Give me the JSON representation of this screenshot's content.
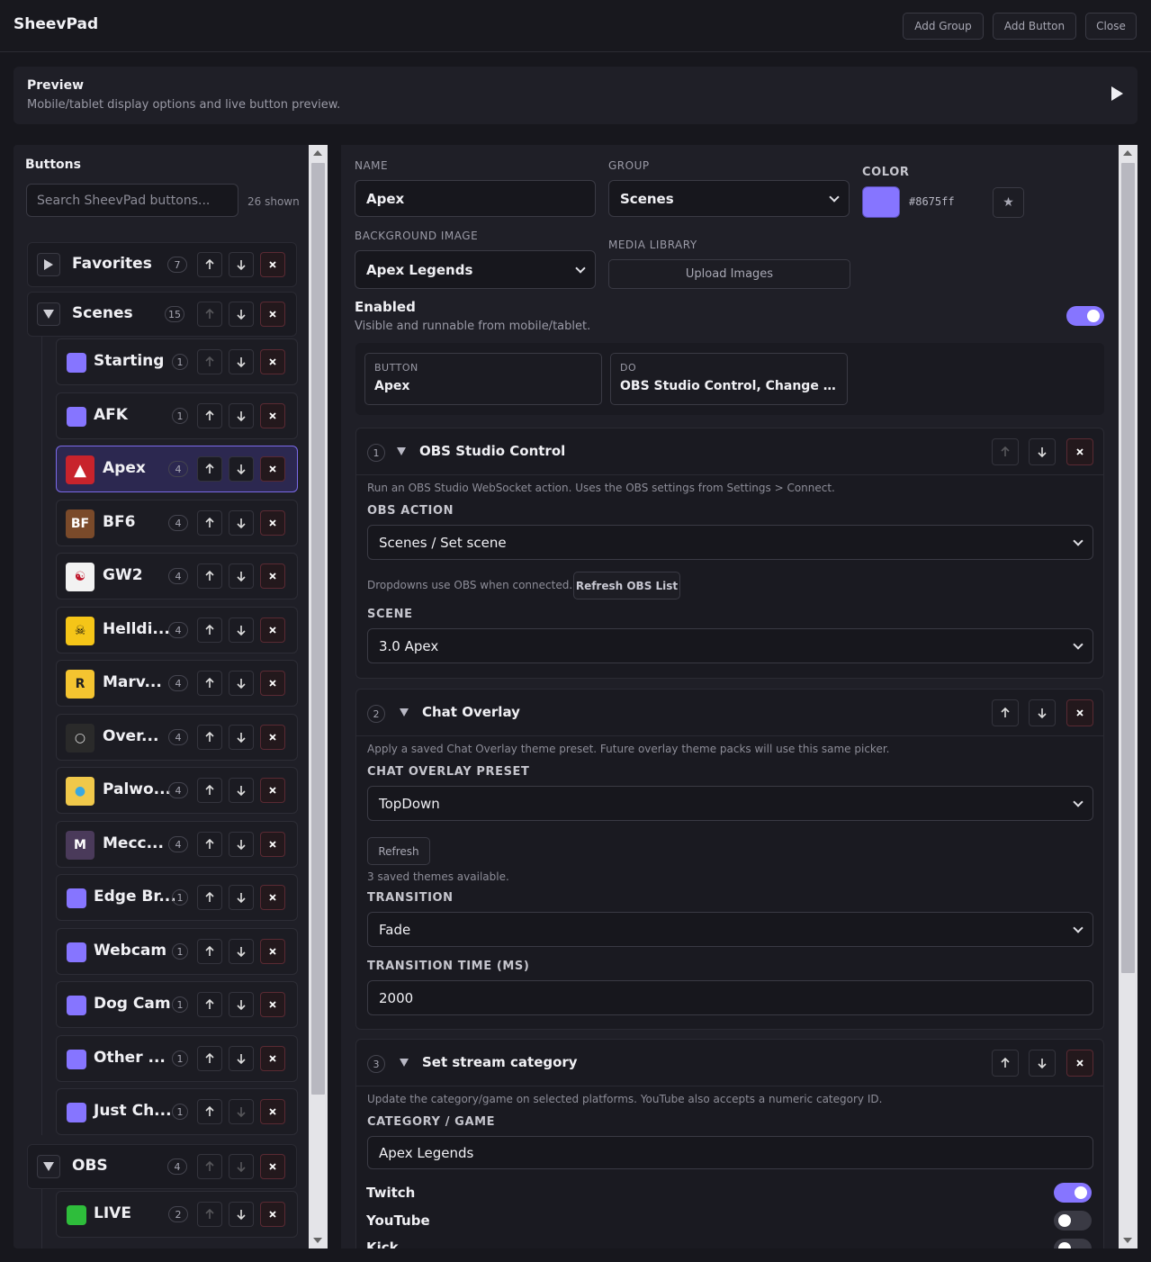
{
  "app": {
    "title": "SheevPad"
  },
  "toolbar": {
    "add_group": "Add Group",
    "add_button": "Add Button",
    "close": "Close"
  },
  "preview": {
    "title": "Preview",
    "subtitle": "Mobile/tablet display options and live button preview."
  },
  "buttons_panel": {
    "heading": "Buttons",
    "search_placeholder": "Search SheevPad buttons...",
    "shown": "26 shown",
    "groups": [
      {
        "name": "Favorites",
        "count": "7"
      },
      {
        "name": "Scenes",
        "count": "15"
      },
      {
        "name": "OBS",
        "count": "4"
      }
    ],
    "items": [
      {
        "name": "Starting",
        "count": "1"
      },
      {
        "name": "AFK",
        "count": "1"
      },
      {
        "name": "Apex",
        "count": "4"
      },
      {
        "name": "BF6",
        "count": "4"
      },
      {
        "name": "GW2",
        "count": "4"
      },
      {
        "name": "Helldi...",
        "count": "4"
      },
      {
        "name": "Marv...",
        "count": "4"
      },
      {
        "name": "Over...",
        "count": "4"
      },
      {
        "name": "Palwo...",
        "count": "4"
      },
      {
        "name": "Mecc...",
        "count": "4"
      },
      {
        "name": "Edge Br...",
        "count": "1"
      },
      {
        "name": "Webcam",
        "count": "1"
      },
      {
        "name": "Dog Cam",
        "count": "1"
      },
      {
        "name": "Other ...",
        "count": "1"
      },
      {
        "name": "Just Ch...",
        "count": "1"
      },
      {
        "name": "LIVE",
        "count": "2"
      }
    ]
  },
  "editor": {
    "name_label": "NAME",
    "name_value": "Apex",
    "group_label": "GROUP",
    "group_value": "Scenes",
    "color_label": "COLOR",
    "color_value": "#8675ff",
    "bg_label": "BACKGROUND IMAGE",
    "bg_value": "Apex Legends",
    "media_label": "MEDIA LIBRARY",
    "upload": "Upload Images",
    "enabled_title": "Enabled",
    "enabled_desc": "Visible and runnable from mobile/tablet.",
    "summary": {
      "button_key": "BUTTON",
      "button_val": "Apex",
      "do_key": "DO",
      "do_val": "OBS Studio Control, Change Chat O..."
    }
  },
  "actions": [
    {
      "num": "1",
      "title": "OBS Studio Control",
      "desc": "Run an OBS Studio WebSocket action. Uses the OBS settings from Settings > Connect.",
      "obs_action_label": "OBS ACTION",
      "obs_action_value": "Scenes / Set scene",
      "hint": "Dropdowns use OBS when connected.",
      "refresh": "Refresh OBS List",
      "scene_label": "SCENE",
      "scene_value": "3.0 Apex"
    },
    {
      "num": "2",
      "title": "Chat Overlay",
      "desc": "Apply a saved Chat Overlay theme preset. Future overlay theme packs will use this same picker.",
      "preset_label": "CHAT OVERLAY PRESET",
      "preset_value": "TopDown",
      "refresh": "Refresh",
      "saved": "3 saved themes available.",
      "transition_label": "TRANSITION",
      "transition_value": "Fade",
      "time_label": "TRANSITION TIME (MS)",
      "time_value": "2000"
    },
    {
      "num": "3",
      "title": "Set stream category",
      "desc": "Update the category/game on selected platforms. YouTube also accepts a numeric category ID.",
      "category_label": "CATEGORY / GAME",
      "category_value": "Apex Legends",
      "platforms": [
        {
          "name": "Twitch",
          "on": true
        },
        {
          "name": "YouTube",
          "on": false
        },
        {
          "name": "Kick",
          "on": false
        }
      ]
    }
  ],
  "colors": {
    "accent": "#8675ff",
    "live": "#2ebd3b",
    "danger": "#ff5a6e"
  }
}
